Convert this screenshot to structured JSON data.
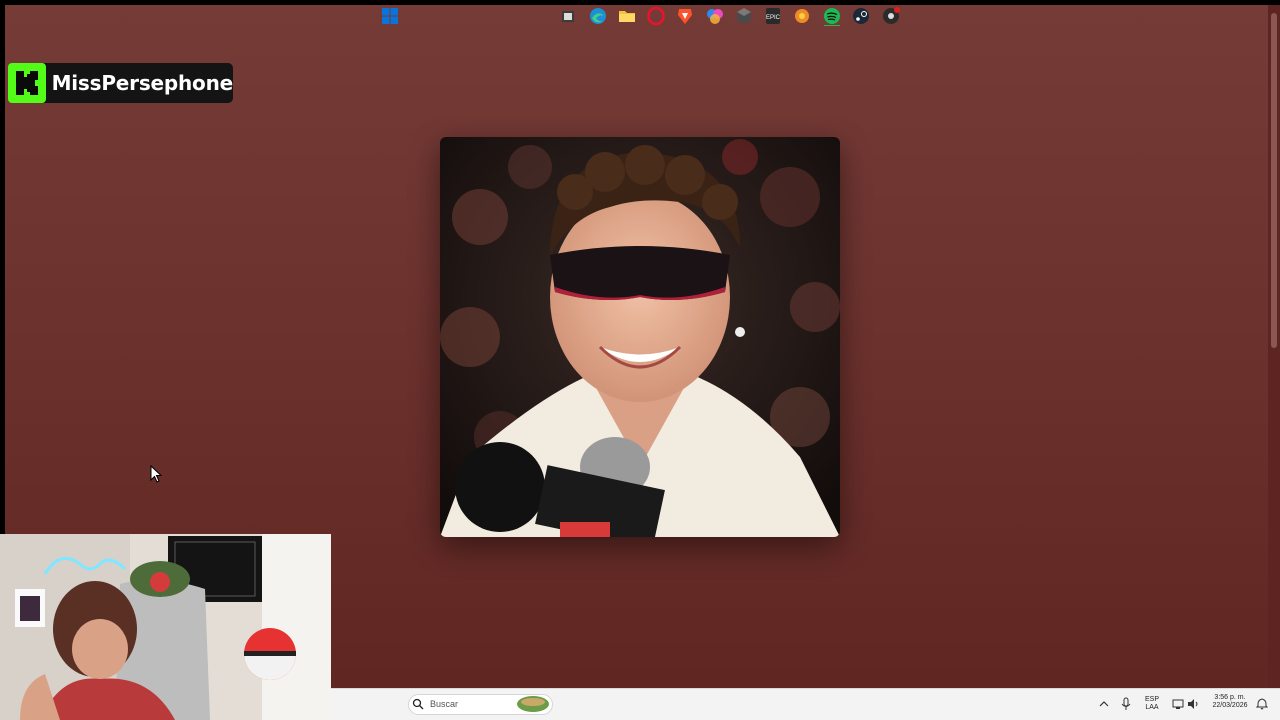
{
  "brand": {
    "name": "MissPersephone",
    "logo_icon": "kick-logo-icon",
    "logo_color": "#53fc18"
  },
  "background": {
    "color": "#6d332f"
  },
  "album": {
    "icon": "album-cover-image"
  },
  "taskbar": {
    "search_placeholder": "Buscar",
    "language": "ESP",
    "language_sub": "LAA",
    "time": "3:56 p. m.",
    "date": "22/03/2026",
    "icons": [
      "windows-start-icon",
      "search-icon",
      "task-view-icon",
      "edge-icon",
      "file-explorer-icon",
      "opera-icon",
      "brave-icon",
      "copilot-icon",
      "app-icon",
      "epic-games-icon",
      "photos-icon",
      "spotify-icon",
      "steam-icon",
      "obs-icon"
    ]
  }
}
